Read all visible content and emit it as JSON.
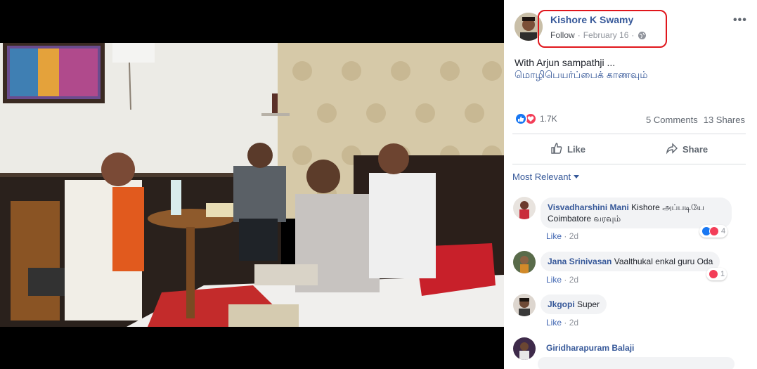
{
  "post": {
    "author": "Kishore K Swamy",
    "follow_label": "Follow",
    "separator": "·",
    "date": "February 16",
    "text": "With Arjun sampathji ...",
    "translate_label": "மொழிபெயர்ப்பைக் காணவும்",
    "reaction_count": "1.7K",
    "comments_label": "5 Comments",
    "shares_label": "13 Shares",
    "more_label": "•••"
  },
  "actions": {
    "like_label": "Like",
    "share_label": "Share"
  },
  "comments_header": {
    "sort_label": "Most Relevant"
  },
  "comments": [
    {
      "name": "Visvadharshini Mani",
      "text_line1": "Kishore அப்படியே",
      "text_line2": "Coimbatore வரவும்",
      "like_label": "Like",
      "time": "2d",
      "reaction_count": "4"
    },
    {
      "name": "Jana Srinivasan",
      "text": "Vaalthukal enkal guru Oda",
      "like_label": "Like",
      "time": "2d",
      "reaction_count": "1"
    },
    {
      "name": "Jkgopi",
      "text": "Super",
      "like_label": "Like",
      "time": "2d"
    },
    {
      "name": "Giridharapuram Balaji",
      "text": ""
    }
  ],
  "colors": {
    "link_blue": "#365899",
    "like_blue": "#1877f2",
    "love_red": "#f33e58",
    "highlight_red": "#e0161c"
  },
  "icons": {
    "reaction_like": "thumbs-up-icon",
    "reaction_love": "heart-icon",
    "like_action": "thumbs-up-outline-icon",
    "share_action": "share-arrow-icon",
    "privacy": "globe-icon",
    "menu": "more-dots-icon"
  }
}
